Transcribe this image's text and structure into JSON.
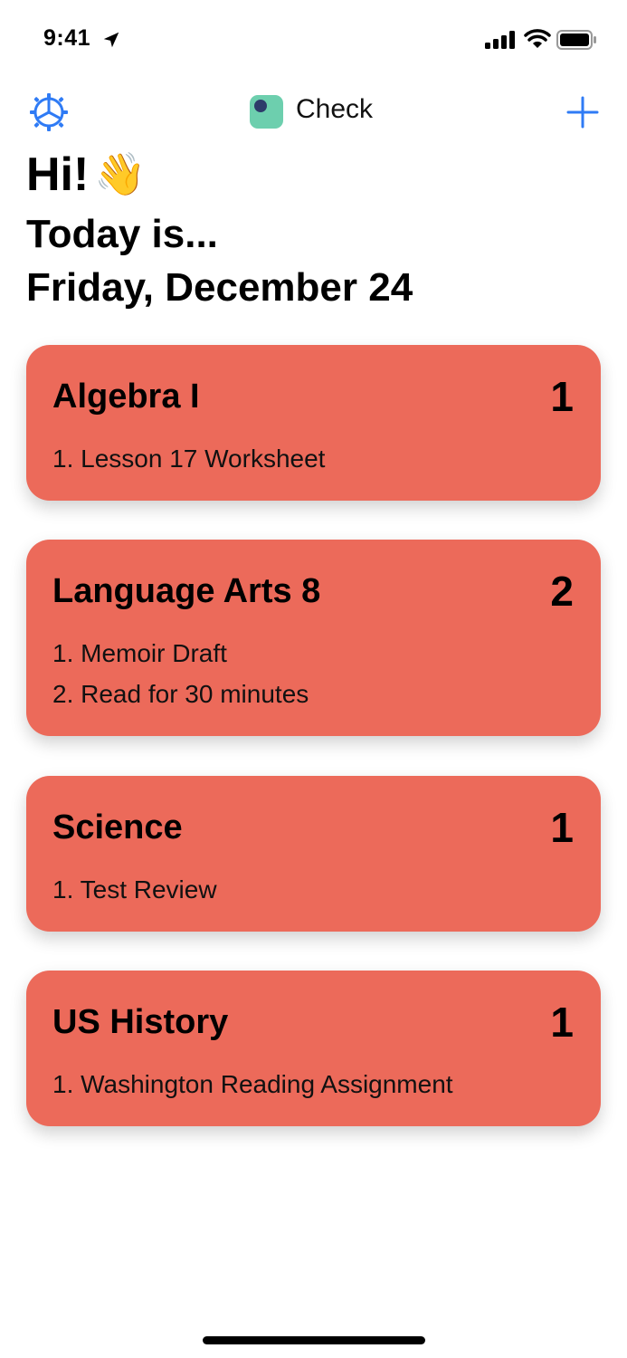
{
  "status_bar": {
    "time": "9:41",
    "icons": [
      "location-arrow-icon",
      "cellular-signal-icon",
      "wifi-icon",
      "battery-icon"
    ]
  },
  "nav": {
    "app_title": "Check",
    "left_icon": "gear-icon",
    "right_icon": "plus-icon",
    "accent_color": "#2f7bf5",
    "logo_color": "#6dcfae"
  },
  "greeting": {
    "hi": "Hi!",
    "emoji": "👋",
    "today": "Today is...",
    "date": "Friday, December 24"
  },
  "card_color": "#ec6a5a",
  "classes": [
    {
      "title": "Algebra I",
      "count": "1",
      "tasks": [
        "1. Lesson 17 Worksheet"
      ]
    },
    {
      "title": "Language Arts 8",
      "count": "2",
      "tasks": [
        "1. Memoir Draft",
        "2. Read for 30 minutes"
      ]
    },
    {
      "title": "Science",
      "count": "1",
      "tasks": [
        "1. Test Review"
      ]
    },
    {
      "title": "US History",
      "count": "1",
      "tasks": [
        "1. Washington Reading Assignment"
      ]
    }
  ]
}
